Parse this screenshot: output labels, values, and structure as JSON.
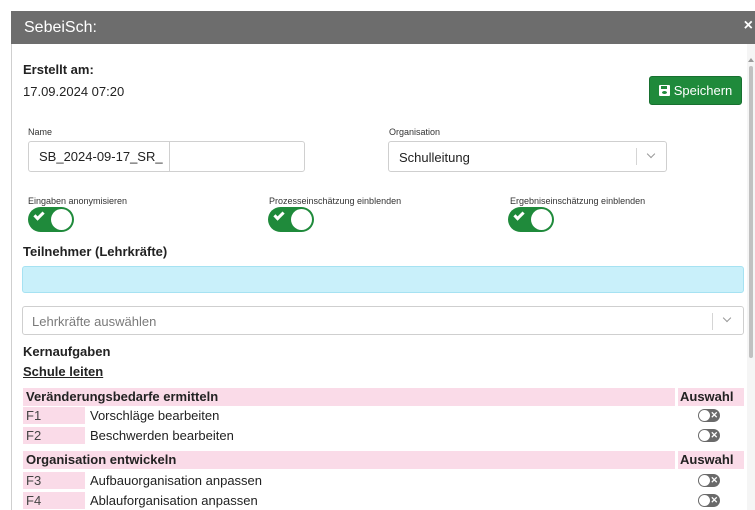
{
  "window": {
    "title": "SebeiSch:",
    "close_symbol": "×"
  },
  "created": {
    "label": "Erstellt am:",
    "value": "17.09.2024 07:20"
  },
  "save_button": {
    "label": "Speichern",
    "color": "#1f8a3b"
  },
  "name_field": {
    "label": "Name",
    "value": "SB_2024-09-17_SR_"
  },
  "organisation_field": {
    "label": "Organisation",
    "value": "Schulleitung"
  },
  "toggles": [
    {
      "label": "Eingaben anonymisieren",
      "on": true
    },
    {
      "label": "Prozesseinschätzung einblenden",
      "on": true
    },
    {
      "label": "Ergebniseinschätzung einblenden",
      "on": true
    }
  ],
  "participants": {
    "heading": "Teilnehmer (Lehrkräfte)",
    "select_placeholder": "Lehrkräfte auswählen"
  },
  "core_tasks": {
    "heading": "Kernaufgaben",
    "section": "Schule leiten",
    "groups": [
      {
        "name": "Veränderungsbedarfe ermitteln",
        "select_header": "Auswahl",
        "items": [
          {
            "code": "F1",
            "label": "Vorschläge bearbeiten",
            "selected": false
          },
          {
            "code": "F2",
            "label": "Beschwerden bearbeiten",
            "selected": false
          }
        ]
      },
      {
        "name": "Organisation entwickeln",
        "select_header": "Auswahl",
        "items": [
          {
            "code": "F3",
            "label": "Aufbauorganisation anpassen",
            "selected": false
          },
          {
            "code": "F4",
            "label": "Ablauforganisation anpassen",
            "selected": false
          }
        ]
      }
    ]
  },
  "colors": {
    "titlebar": "#6d6d6d",
    "accent_green": "#1f8a3b",
    "participants_bg": "#c9f0fa",
    "group_bg": "#fadbe8"
  }
}
